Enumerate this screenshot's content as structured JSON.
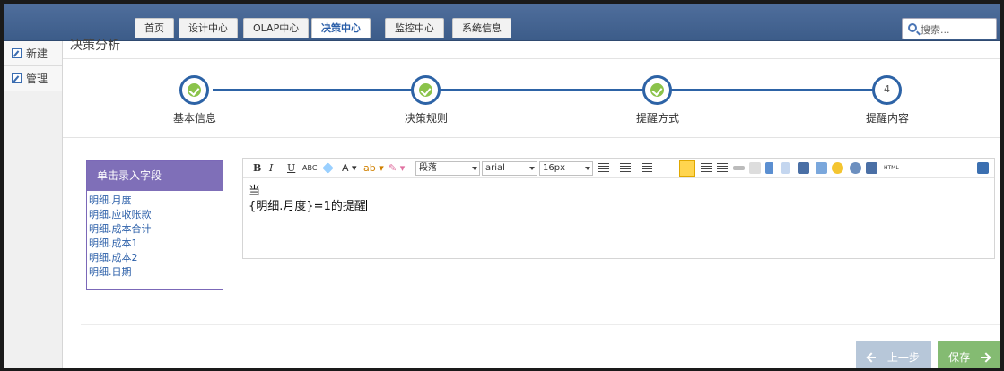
{
  "nav": {
    "tabs": [
      {
        "label": "首页"
      },
      {
        "label": "设计中心"
      },
      {
        "label": "OLAP中心"
      },
      {
        "label": "决策中心"
      },
      {
        "label": "监控中心"
      },
      {
        "label": "系统信息"
      }
    ],
    "active_tab": "决策中心",
    "search_placeholder": "搜索..."
  },
  "sidebar": {
    "items": [
      {
        "label": "新建",
        "icon": "edit-icon"
      },
      {
        "label": "管理",
        "icon": "edit-icon"
      }
    ]
  },
  "main": {
    "title": "决策分析"
  },
  "steps": [
    {
      "label": "基本信息",
      "status": "done"
    },
    {
      "label": "决策规则",
      "status": "done"
    },
    {
      "label": "提醒方式",
      "status": "done"
    },
    {
      "label": "提醒内容",
      "status": "current",
      "number": "4"
    }
  ],
  "field_panel": {
    "title": "单击录入字段",
    "fields": [
      "明细.月度",
      "明细.应收账款",
      "明细.成本合计",
      "明细.成本1",
      "明细.成本2",
      "明细.日期"
    ]
  },
  "editor": {
    "paragraph_select": "段落",
    "font_select": "arial",
    "size_select": "16px",
    "content_line1": "当",
    "content_line2": "{明细.月度}=1的提醒",
    "toolbar_buttons": [
      "B",
      "I",
      "U"
    ]
  },
  "buttons": {
    "prev_label": "上一步",
    "save_label": "保存"
  },
  "colors": {
    "nav_bg": "#4a6a98",
    "step_line": "#2d63a6",
    "check_green": "#8bc34a",
    "panel_purple": "#7f6fb8",
    "save_green": "#84bb72",
    "prev_blue": "#b7c7d9"
  }
}
